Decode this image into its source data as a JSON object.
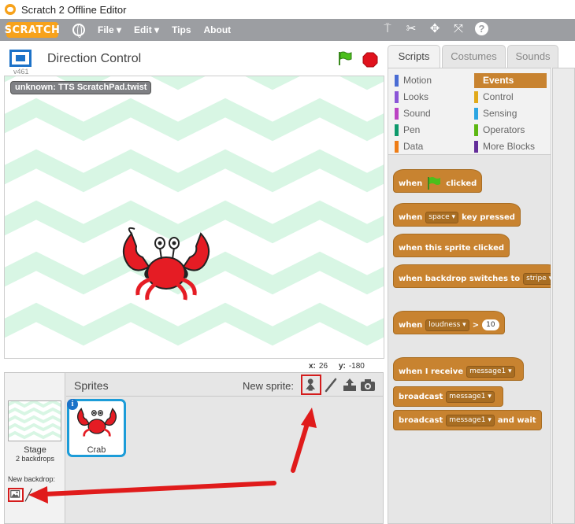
{
  "window": {
    "title": "Scratch 2 Offline Editor"
  },
  "menubar": {
    "logo": "SCRATCH",
    "items": [
      "File",
      "Edit",
      "Tips",
      "About"
    ]
  },
  "stage_header": {
    "version": "v461",
    "project_title": "Direction Control"
  },
  "stage": {
    "watcher_label": "unknown: TTS ScratchPad.twist",
    "coords": {
      "x_label": "x:",
      "x_value": "26",
      "y_label": "y:",
      "y_value": "-180"
    }
  },
  "sprite_pane": {
    "title": "Sprites",
    "new_sprite_label": "New sprite:",
    "stage_label": "Stage",
    "stage_backdrops": "2 backdrops",
    "new_backdrop_label": "New backdrop:",
    "sprites": [
      {
        "name": "Crab"
      }
    ]
  },
  "tabs": [
    "Scripts",
    "Costumes",
    "Sounds"
  ],
  "categories": [
    {
      "label": "Motion",
      "color": "#4a6cd4"
    },
    {
      "label": "Events",
      "color": "#c88330",
      "selected": true
    },
    {
      "label": "Looks",
      "color": "#8a55d7"
    },
    {
      "label": "Control",
      "color": "#e1a91a"
    },
    {
      "label": "Sound",
      "color": "#bb42c3"
    },
    {
      "label": "Sensing",
      "color": "#2ca5e2"
    },
    {
      "label": "Pen",
      "color": "#0e9a6c"
    },
    {
      "label": "Operators",
      "color": "#5cb712"
    },
    {
      "label": "Data",
      "color": "#ee7d16"
    },
    {
      "label": "More Blocks",
      "color": "#632d99"
    }
  ],
  "blocks": {
    "when_flag": {
      "pre": "when",
      "post": "clicked"
    },
    "when_key": {
      "pre": "when",
      "key": "space",
      "post": "key pressed"
    },
    "when_sprite": {
      "text": "when this sprite clicked"
    },
    "when_backdrop": {
      "text": "when backdrop switches to",
      "value": "stripe"
    },
    "when_loudness": {
      "pre": "when",
      "sensor": "loudness",
      "op": ">",
      "value": "10"
    },
    "when_receive": {
      "pre": "when I receive",
      "msg": "message1"
    },
    "broadcast": {
      "pre": "broadcast",
      "msg": "message1"
    },
    "broadcast_wait": {
      "pre": "broadcast",
      "msg": "message1",
      "post": "and wait"
    }
  },
  "colors": {
    "accent": "#1c9cd8",
    "events": "#c88330",
    "highlight": "#d41c1c",
    "menubar": "#9c9ea2"
  }
}
